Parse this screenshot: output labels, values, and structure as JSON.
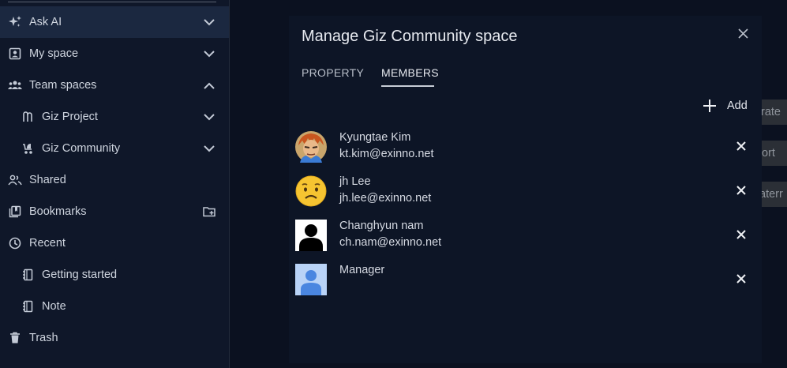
{
  "sidebar": {
    "items": [
      {
        "label": "Ask AI",
        "icon": "sparkle-icon",
        "trail": "chevron-down-icon"
      },
      {
        "label": "My space",
        "icon": "person-box-icon",
        "trail": "chevron-down-icon"
      },
      {
        "label": "Team spaces",
        "icon": "group-icon",
        "trail": "chevron-up-icon"
      },
      {
        "label": "Giz Project",
        "icon": "hand-icon",
        "trail": "chevron-down-icon"
      },
      {
        "label": "Giz Community",
        "icon": "stroller-icon",
        "trail": "chevron-down-icon"
      },
      {
        "label": "Shared",
        "icon": "people-share-icon",
        "trail": ""
      },
      {
        "label": "Bookmarks",
        "icon": "bookmarks-icon",
        "trail": "new-folder-icon"
      },
      {
        "label": "Recent",
        "icon": "clock-icon",
        "trail": ""
      },
      {
        "label": "Getting started",
        "icon": "notebook-icon",
        "trail": ""
      },
      {
        "label": "Note",
        "icon": "notebook-icon",
        "trail": ""
      },
      {
        "label": "Trash",
        "icon": "trash-icon",
        "trail": ""
      }
    ]
  },
  "background_buttons": [
    "rate",
    "ort",
    "aterr"
  ],
  "modal": {
    "title": "Manage Giz Community space",
    "tabs": [
      {
        "label": "PROPERTY",
        "active": false
      },
      {
        "label": "MEMBERS",
        "active": true
      }
    ],
    "add_label": "Add",
    "members": [
      {
        "name": "Kyungtae Kim",
        "email": "kt.kim@exinno.net",
        "avatar": "cartoon-avatar"
      },
      {
        "name": "jh Lee",
        "email": "jh.lee@exinno.net",
        "avatar": "worried-emoji-avatar"
      },
      {
        "name": "Changhyun nam",
        "email": "ch.nam@exinno.net",
        "avatar": "silhouette-avatar"
      },
      {
        "name": "Manager",
        "email": "",
        "avatar": "default-blue-avatar"
      }
    ]
  },
  "colors": {
    "background": "#0b1120",
    "sidebar": "#0f1729",
    "sidebar_active": "#1b2840",
    "modal": "#0d1526",
    "text": "#d6dae3"
  }
}
